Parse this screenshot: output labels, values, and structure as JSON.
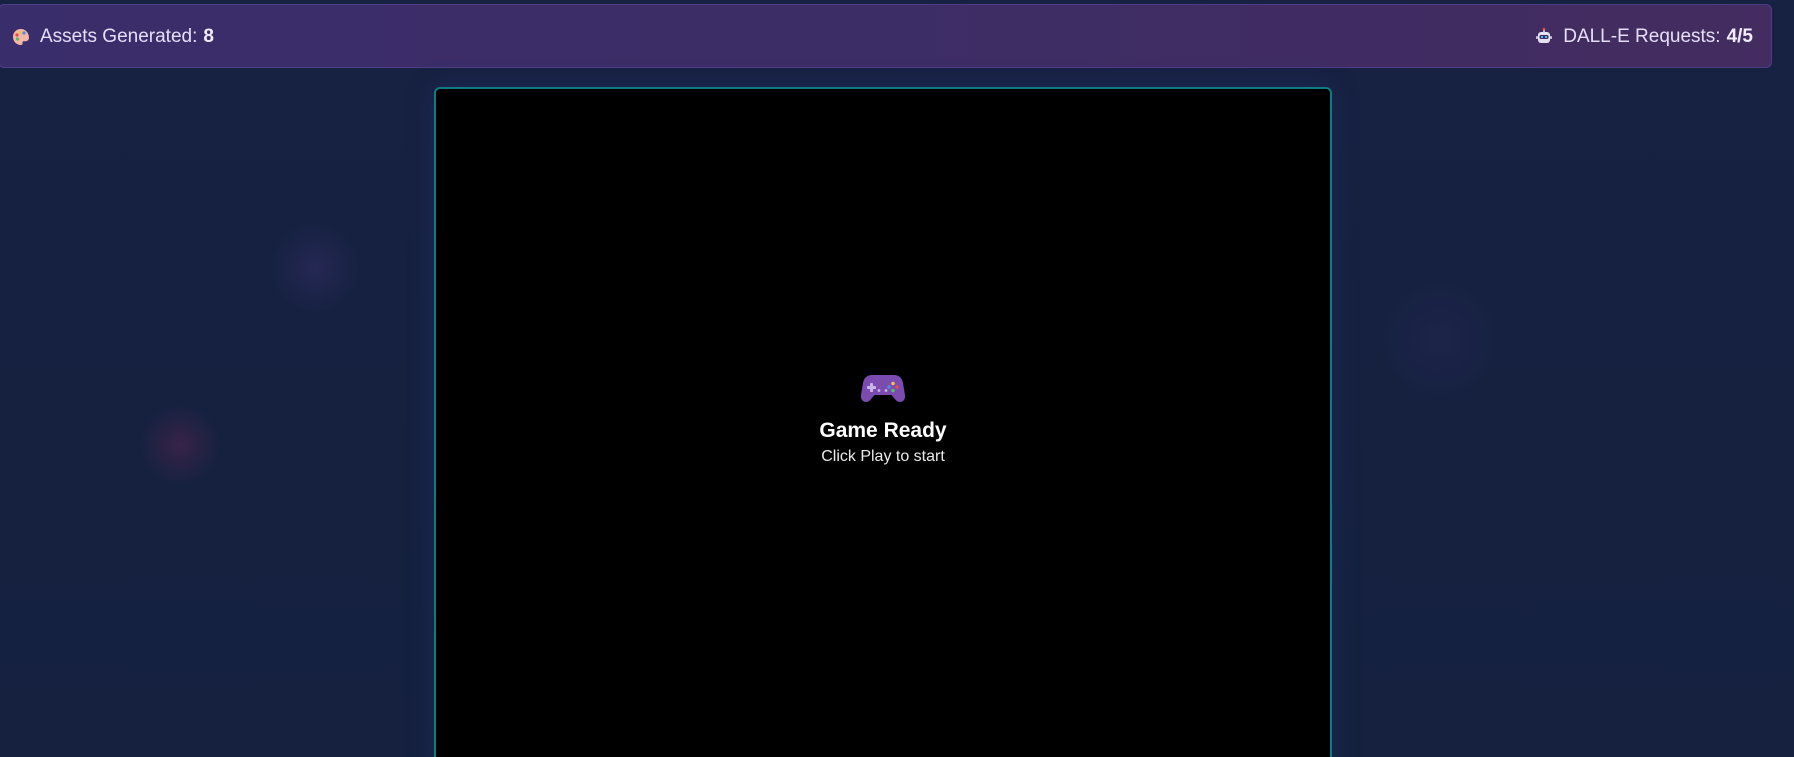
{
  "header": {
    "assets": {
      "icon": "palette-icon",
      "label": "Assets Generated:",
      "value": "8"
    },
    "dalle": {
      "icon": "robot-icon",
      "label": "DALL-E Requests:",
      "value": "4/5"
    }
  },
  "game": {
    "icon": "game-controller-icon",
    "title": "Game Ready",
    "subtitle": "Click Play to start"
  },
  "colors": {
    "background": "#15213f",
    "header_start": "#3a2d6b",
    "header_end": "#432c5f",
    "frame_border": "#0f7c83",
    "canvas": "#000000",
    "controller": "#7b4bb0"
  }
}
